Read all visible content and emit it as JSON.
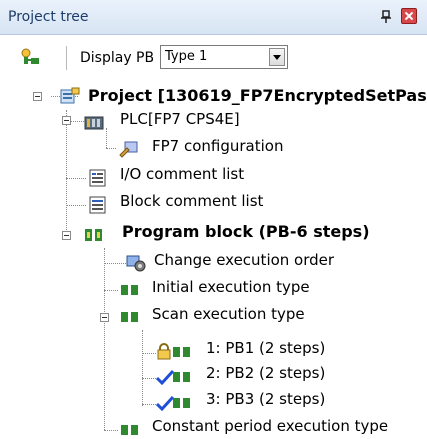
{
  "panel": {
    "title": "Project tree"
  },
  "toolbar": {
    "display_label": "Display PB",
    "select_value": "Type 1"
  },
  "tree": {
    "project": "Project [130619_FP7EncryptedSetPas",
    "plc": "PLC[FP7 CPS4E]",
    "config": "FP7 configuration",
    "io_comment": "I/O comment list",
    "block_comment": "Block comment list",
    "program_block": "Program block (PB-6 steps)",
    "change_order": "Change execution order",
    "initial_type": "Initial execution type",
    "scan_type": "Scan execution type",
    "pb1": "1: PB1 (2 steps)",
    "pb2": "2: PB2 (2 steps)",
    "pb3": "3: PB3 (2 steps)",
    "constant_type": "Constant period execution type"
  },
  "colors": {
    "title_text": "#1d3c6b",
    "close_button": "#d8474a",
    "check": "#1f4fd6",
    "pb_icon_green": "#2f8a2f"
  }
}
